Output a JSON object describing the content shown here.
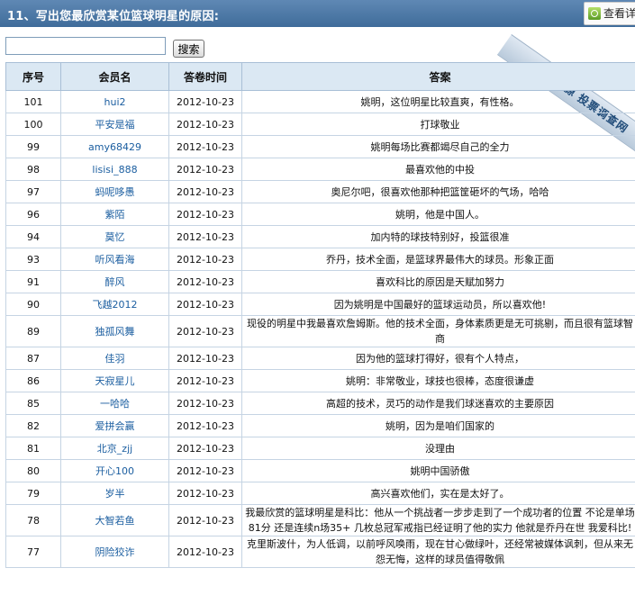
{
  "header": {
    "title": "11、写出您最欣赏某位篮球明星的原因:",
    "ribbon_text": "数据来源 投票调查网",
    "view_button": "查看详"
  },
  "search": {
    "value": "",
    "button_label": "搜索"
  },
  "table": {
    "columns": [
      "序号",
      "会员名",
      "答卷时间",
      "答案"
    ],
    "rows": [
      {
        "id": "101",
        "member": "hui2",
        "date": "2012-10-23",
        "answer": "姚明，这位明星比较直爽，有性格。"
      },
      {
        "id": "100",
        "member": "平安是福",
        "date": "2012-10-23",
        "answer": "打球敬业"
      },
      {
        "id": "99",
        "member": "amy68429",
        "date": "2012-10-23",
        "answer": "姚明每场比赛都竭尽自己的全力"
      },
      {
        "id": "98",
        "member": "lisisi_888",
        "date": "2012-10-23",
        "answer": "最喜欢他的中投"
      },
      {
        "id": "97",
        "member": "蚂呢哆愚",
        "date": "2012-10-23",
        "answer": "奥尼尔吧，很喜欢他那种把篮筐砸坏的气场，哈哈"
      },
      {
        "id": "96",
        "member": "紫陌",
        "date": "2012-10-23",
        "answer": "姚明，他是中国人。"
      },
      {
        "id": "94",
        "member": "莫忆",
        "date": "2012-10-23",
        "answer": "加内特的球技特别好，投篮很准"
      },
      {
        "id": "93",
        "member": "听风看海",
        "date": "2012-10-23",
        "answer": "乔丹，技术全面，是篮球界最伟大的球员。形象正面"
      },
      {
        "id": "91",
        "member": "醉风",
        "date": "2012-10-23",
        "answer": "喜欢科比的原因是天赋加努力"
      },
      {
        "id": "90",
        "member": "飞越2012",
        "date": "2012-10-23",
        "answer": "因为姚明是中国最好的篮球运动员，所以喜欢他!"
      },
      {
        "id": "89",
        "member": "独孤风舞",
        "date": "2012-10-23",
        "answer": "现役的明星中我最喜欢詹姆斯。他的技术全面，身体素质更是无可挑剔，而且很有篮球智商"
      },
      {
        "id": "87",
        "member": "佳羽",
        "date": "2012-10-23",
        "answer": "因为他的篮球打得好，很有个人特点，"
      },
      {
        "id": "86",
        "member": "天寂星儿",
        "date": "2012-10-23",
        "answer": "姚明：非常敬业，球技也很棒，态度很谦虚"
      },
      {
        "id": "85",
        "member": "一哈哈",
        "date": "2012-10-23",
        "answer": "高超的技术，灵巧的动作是我们球迷喜欢的主要原因"
      },
      {
        "id": "82",
        "member": "爱拼会赢",
        "date": "2012-10-23",
        "answer": "姚明，因为是咱们国家的"
      },
      {
        "id": "81",
        "member": "北京_zjj",
        "date": "2012-10-23",
        "answer": "没理由"
      },
      {
        "id": "80",
        "member": "开心100",
        "date": "2012-10-23",
        "answer": "姚明中国骄傲"
      },
      {
        "id": "79",
        "member": "岁半",
        "date": "2012-10-23",
        "answer": "高兴喜欢他们，实在是太好了。"
      },
      {
        "id": "78",
        "member": "大智若鱼",
        "date": "2012-10-23",
        "answer": "我最欣赏的篮球明星是科比：他从一个挑战者一步步走到了一个成功者的位置 不论是单场81分 还是连续n场35+ 几枚总冠军戒指已经证明了他的实力 他就是乔丹在世 我爱科比!"
      },
      {
        "id": "77",
        "member": "阴险狡诈",
        "date": "2012-10-23",
        "answer": "克里斯波什，为人低调，以前呼风唤雨，现在甘心做绿叶，还经常被媒体讽刺，但从来无怨无悔，这样的球员值得敬佩"
      }
    ]
  }
}
